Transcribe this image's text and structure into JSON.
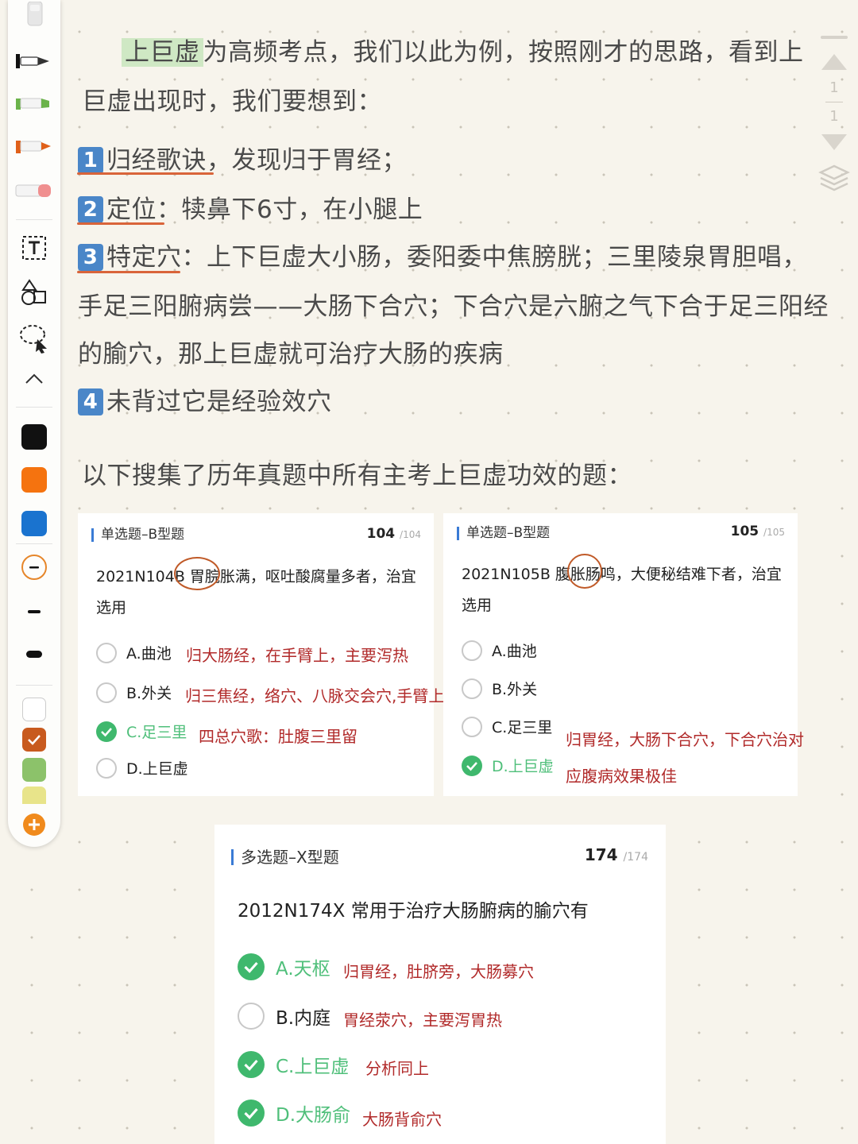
{
  "toolbar": {
    "tools": [
      "eraser-icon",
      "pen-icon",
      "highlighter-green-icon",
      "marker-orange-icon",
      "eraser-pink-icon",
      "text-tool-icon",
      "shapes-icon",
      "lasso-select-icon",
      "collapse-chevron-icon"
    ],
    "colors": [
      "#111111",
      "#f5730f",
      "#1a73cf"
    ],
    "swatches": [
      "#ffffff",
      "#c85a1e",
      "#8cc26a",
      "#e8e48a"
    ],
    "pages_current": "1",
    "pages_total": "1"
  },
  "notes": {
    "intro_hl": "上巨虚",
    "intro_rest": "为高频考点，我们以此为例，按照刚才的思路，看到上",
    "intro_line2": "巨虚出现时，我们要想到：",
    "p1_num": "1",
    "p1_text": "归经歌诀，发现归于胃经；",
    "p2_num": "2",
    "p2_text": "定位：犊鼻下6寸，在小腿上",
    "p3_num": "3",
    "p3_text": "特定穴：上下巨虚大小肠，委阳委中焦膀胱；三里陵泉胃胆唱，",
    "p3_line2": "手足三阳腑病尝——大肠下合穴；下合穴是六腑之气下合于足三阳经",
    "p3_line3": "的腧穴，那上巨虚就可治疗大肠的疾病",
    "p4_num": "4",
    "p4_text": "未背过它是经验效穴",
    "summary": "以下搜集了历年真题中所有主考上巨虚功效的题："
  },
  "card1": {
    "type": "单选题–B型题",
    "num": "104",
    "total": "/104",
    "q_line1": "2021N104B 胃脘胀满，呕吐酸腐量多者，治宜",
    "q_line2": "选用",
    "options": [
      {
        "label": "A.曲池",
        "note": "归大肠经，在手臂上，主要泻热"
      },
      {
        "label": "B.外关",
        "note": "归三焦经，络穴、八脉交会穴,手臂上"
      },
      {
        "label": "C.足三里",
        "note": "四总穴歌：肚腹三里留"
      },
      {
        "label": "D.上巨虚",
        "note": ""
      }
    ]
  },
  "card2": {
    "type": "单选题–B型题",
    "num": "105",
    "total": "/105",
    "q_line1": "2021N105B 腹胀肠鸣，大便秘结难下者，治宜",
    "q_line2": "选用",
    "options": [
      {
        "label": "A.曲池"
      },
      {
        "label": "B.外关"
      },
      {
        "label": "C.足三里"
      },
      {
        "label": "D.上巨虚"
      }
    ],
    "note_line1": "归胃经，大肠下合穴，下合穴治对",
    "note_line2": "应腹病效果极佳"
  },
  "card3": {
    "type": "多选题–X型题",
    "num": "174",
    "total": "/174",
    "question": "2012N174X 常用于治疗大肠腑病的腧穴有",
    "options": [
      {
        "label": "A.天枢",
        "note": "归胃经，肚脐旁，大肠募穴"
      },
      {
        "label": "B.内庭",
        "note": "胃经荥穴，主要泻胃热"
      },
      {
        "label": "C.上巨虚",
        "note": "分析同上"
      },
      {
        "label": "D.大肠俞",
        "note": "大肠背俞穴"
      }
    ]
  }
}
